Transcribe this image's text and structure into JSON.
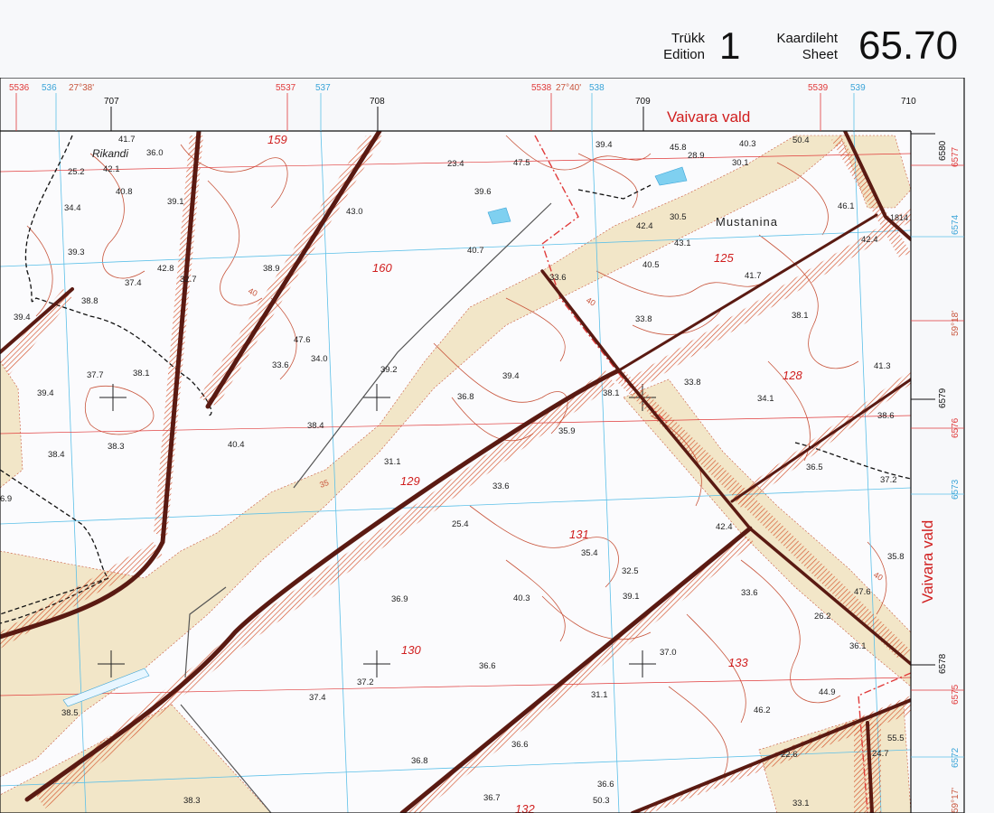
{
  "header": {
    "edition_label_et": "Trükk",
    "edition_label_en": "Edition",
    "edition_number": "1",
    "sheet_label_et": "Kaardileht",
    "sheet_label_en": "Sheet",
    "sheet_number": "65.70"
  },
  "colors": {
    "grid_blue": "#5cc0e8",
    "grid_red": "#e03a3a",
    "contour": "#c8553c",
    "road": "#5a1a12",
    "clearing": "#f2e6c8",
    "frame": "#111111"
  },
  "top_ruler": {
    "red": [
      "5536",
      "5537",
      "5538",
      "5539"
    ],
    "blue": [
      "536",
      "537",
      "538",
      "539"
    ],
    "dms": [
      "27°38'",
      "27°40'"
    ],
    "black": [
      "707",
      "708",
      "709",
      "710"
    ]
  },
  "right_ruler": {
    "black": [
      "6580",
      "6579",
      "6578"
    ],
    "red": [
      "6577",
      "6576",
      "6575"
    ],
    "blue": [
      "6574",
      "6573",
      "6572"
    ],
    "dms": [
      "59°18'",
      "59°17'"
    ]
  },
  "labels": {
    "vald_top": "Vaivara vald",
    "vald_right": "Vaivara vald",
    "village_1": "Rikandi",
    "village_2": "Mustanina"
  },
  "compartments": [
    "159",
    "160",
    "125",
    "128",
    "129",
    "131",
    "130",
    "133",
    "132"
  ],
  "elevations": [
    "41.7",
    "36.0",
    "25.2",
    "42.1",
    "40.8",
    "34.4",
    "39.1",
    "39.3",
    "42.8",
    "37.4",
    "32.7",
    "38.8",
    "39.4",
    "38.9",
    "23.4",
    "47.5",
    "39.6",
    "43.0",
    "40.7",
    "39.4",
    "45.8",
    "28.9",
    "40.3",
    "30.1",
    "50.4",
    "46.1",
    "42.4",
    "30.5",
    "43.1",
    "40.5",
    "33.6",
    "33.8",
    "41.7",
    "42.4",
    "38.1",
    "47.6",
    "34.0",
    "33.6",
    "37.7",
    "38.1",
    "39.4",
    "39.2",
    "36.8",
    "39.4",
    "38.1",
    "33.8",
    "34.1",
    "41.3",
    "38.6",
    "38.4",
    "38.3",
    "40.4",
    "38.4",
    "31.1",
    "35.9",
    "36.5",
    "37.2",
    "33.6",
    "25.4",
    "42.4",
    "35.8",
    "35.4",
    "32.5",
    "39.1",
    "36.9",
    "40.3",
    "33.6",
    "47.6",
    "26.2",
    "36.1",
    "37.0",
    "37.2",
    "36.6",
    "44.9",
    "46.2",
    "37.4",
    "38.5",
    "31.1",
    "36.6",
    "55.5",
    "24.7",
    "22.6",
    "36.8",
    "36.6",
    "36.7",
    "38.3",
    "50.3",
    "33.1",
    "6.9"
  ],
  "misc": {
    "road_number": "1814",
    "contour_40": "40",
    "contour_35": "35"
  }
}
